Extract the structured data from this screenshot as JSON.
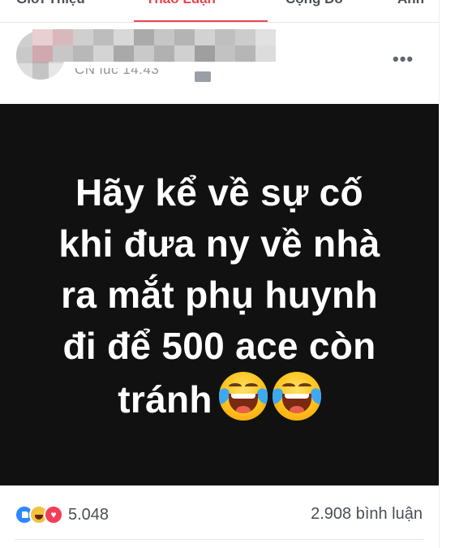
{
  "tabs": [
    "Giới Thiệu",
    "Thảo Luận",
    "Cộng Đồ",
    "Ảnh"
  ],
  "active_tab": 1,
  "post": {
    "time_label": "CN lúc 14:43",
    "text_lines": [
      "Hãy kể về sự cố",
      "khi đưa ny về nhà",
      "ra mắt phụ huynh",
      "đi để 500 ace còn",
      "tránh"
    ],
    "emojis": [
      "laugh-cry-emoji",
      "laugh-cry-emoji"
    ]
  },
  "footer": {
    "reactions": [
      "like-reaction-icon",
      "haha-reaction-icon",
      "love-reaction-icon"
    ],
    "reaction_count": "5.048",
    "comment_count": "2.908 bình luận"
  },
  "colors": {
    "accent": "#e9454d",
    "image_background": "#111111",
    "like": "#2d88ff",
    "love": "#f33e58",
    "haha": "#f7c23b"
  }
}
